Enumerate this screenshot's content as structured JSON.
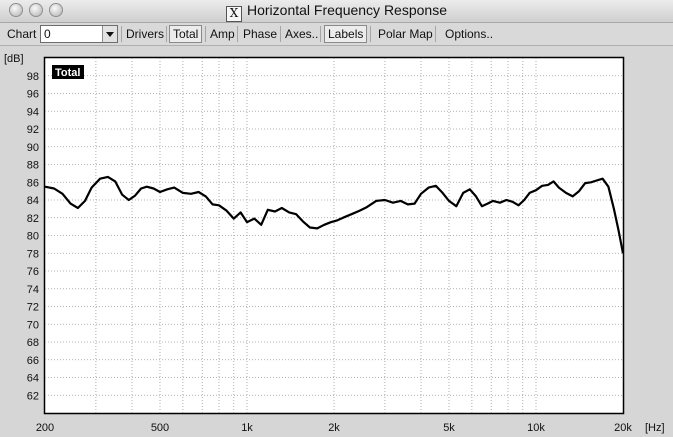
{
  "window": {
    "title": "Horizontal Frequency Response"
  },
  "toolbar": {
    "chart_label": "Chart",
    "chart_value": "0",
    "drivers": "Drivers",
    "total": "Total",
    "amp": "Amp",
    "phase": "Phase",
    "axes": "Axes..",
    "labels": "Labels",
    "polar_map": "Polar Map",
    "options": "Options.."
  },
  "chart_data": {
    "type": "line",
    "title": "",
    "xlabel": "[Hz]",
    "ylabel": "[dB]",
    "xscale": "log",
    "xlim": [
      200,
      20000
    ],
    "ylim": [
      60,
      100
    ],
    "grid": true,
    "legend": "Total",
    "legend_position": "top-left",
    "x_tick_labels": [
      "200",
      "500",
      "1k",
      "2k",
      "5k",
      "10k",
      "20k"
    ],
    "y_tick_labels": [
      "62",
      "64",
      "66",
      "68",
      "70",
      "72",
      "74",
      "76",
      "78",
      "80",
      "82",
      "84",
      "86",
      "88",
      "90",
      "92",
      "94",
      "96",
      "98"
    ],
    "series": [
      {
        "name": "Total",
        "color": "#000000",
        "x": [
          200,
          215,
          230,
          245,
          260,
          275,
          290,
          310,
          330,
          350,
          370,
          390,
          410,
          430,
          450,
          475,
          500,
          530,
          560,
          600,
          640,
          680,
          720,
          760,
          800,
          850,
          900,
          950,
          1000,
          1060,
          1120,
          1180,
          1250,
          1320,
          1400,
          1480,
          1560,
          1650,
          1750,
          1850,
          1950,
          2050,
          2150,
          2300,
          2450,
          2600,
          2800,
          3000,
          3200,
          3400,
          3600,
          3800,
          4000,
          4250,
          4500,
          4750,
          5000,
          5300,
          5600,
          5900,
          6200,
          6500,
          6800,
          7100,
          7500,
          7900,
          8300,
          8700,
          9100,
          9500,
          10000,
          10500,
          11000,
          11500,
          12000,
          12700,
          13400,
          14100,
          14800,
          15500,
          16200,
          17000,
          17800,
          18600,
          19300,
          20000
        ],
        "y": [
          85.5,
          85.3,
          84.7,
          83.6,
          83.1,
          83.9,
          85.4,
          86.4,
          86.6,
          86.1,
          84.6,
          84.0,
          84.5,
          85.3,
          85.5,
          85.3,
          84.9,
          85.2,
          85.4,
          84.8,
          84.7,
          84.9,
          84.4,
          83.5,
          83.4,
          82.8,
          81.9,
          82.6,
          81.5,
          81.9,
          81.2,
          82.9,
          82.7,
          83.1,
          82.6,
          82.4,
          81.6,
          80.9,
          80.8,
          81.2,
          81.5,
          81.7,
          82.0,
          82.4,
          82.8,
          83.2,
          83.9,
          84.0,
          83.7,
          83.9,
          83.5,
          83.6,
          84.7,
          85.4,
          85.6,
          84.8,
          83.9,
          83.3,
          84.8,
          85.2,
          84.4,
          83.3,
          83.6,
          83.9,
          83.7,
          84.0,
          83.8,
          83.4,
          84.0,
          84.8,
          85.1,
          85.6,
          85.7,
          86.1,
          85.4,
          84.8,
          84.4,
          85.0,
          85.9,
          86.0,
          86.2,
          86.4,
          85.5,
          83.0,
          80.6,
          78.0
        ]
      }
    ]
  }
}
